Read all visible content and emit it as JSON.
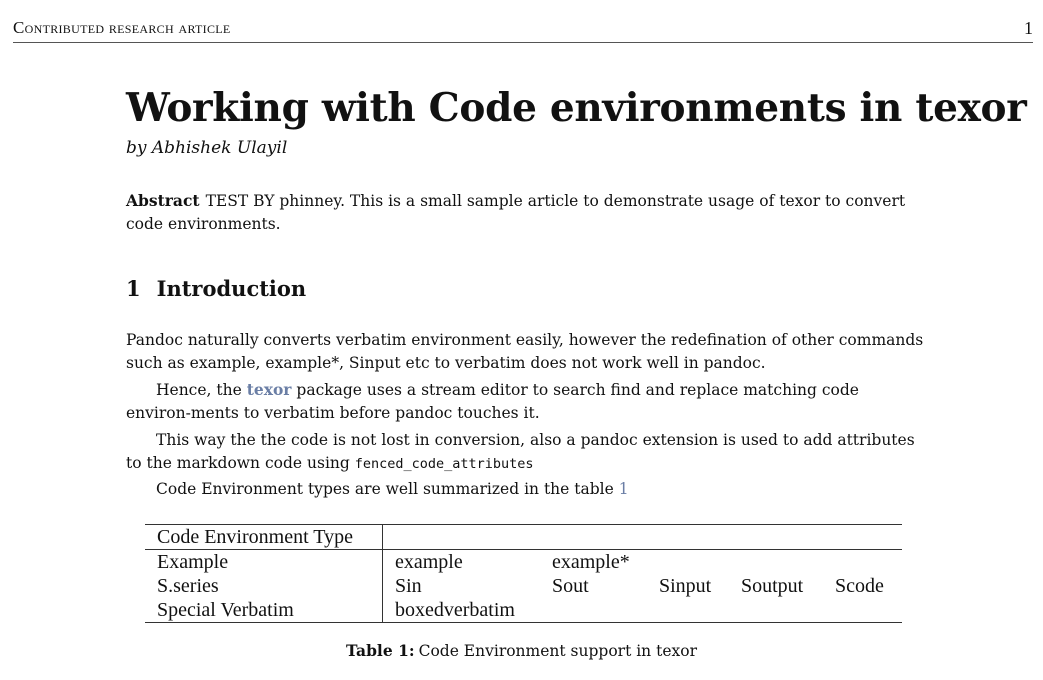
{
  "running_head": {
    "title": "Contributed research article",
    "page_number": "1"
  },
  "article": {
    "title": "Working with Code environments in texor",
    "author_line": "by Abhishek Ulayil",
    "abstract_label": "Abstract",
    "abstract_text": "TEST BY phinney. This is a small sample article to demonstrate usage of texor to convert code environments."
  },
  "section": {
    "number": "1",
    "title": "Introduction"
  },
  "paragraphs": {
    "p1": "Pandoc naturally converts verbatim environment easily, however the redefination of other commands such as example, example*, Sinput etc to verbatim does not work well in pandoc.",
    "p2_before": "Hence, the ",
    "p2_link": "texor",
    "p2_after": " package uses a stream editor to search find and replace matching code environ-ments to verbatim before pandoc touches it.",
    "p3_text": "This way the the code is not lost in conversion, also a pandoc extension is used to add attributes to the markdown code using ",
    "p3_code": "fenced_code_attributes",
    "p4_text": "Code Environment types are well summarized in the table ",
    "p4_ref": "1"
  },
  "table": {
    "header": [
      "Code Environment Type",
      "",
      "",
      "",
      "",
      ""
    ],
    "rows": [
      [
        "Example",
        "example",
        "example*",
        "",
        "",
        ""
      ],
      [
        "S.series",
        "Sin",
        "Sout",
        "Sinput",
        "Soutput",
        "Scode"
      ],
      [
        "Special Verbatim",
        "boxedverbatim",
        "",
        "",
        "",
        ""
      ]
    ]
  },
  "caption": {
    "label": "Table 1:",
    "text": "Code Environment support in texor"
  }
}
